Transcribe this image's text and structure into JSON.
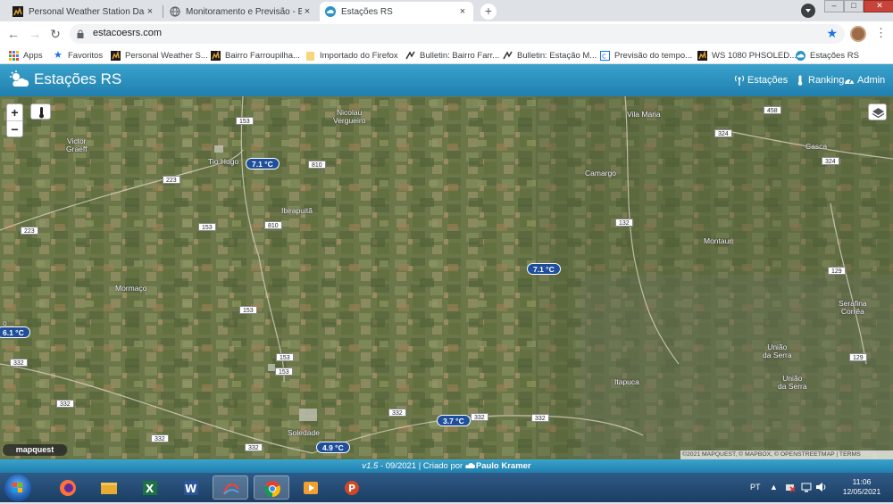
{
  "browser": {
    "tabs": [
      {
        "title": "Personal Weather Station Dashbo",
        "close": "×"
      },
      {
        "title": "Monitoramento e Previsão - Bras",
        "close": "×"
      },
      {
        "title": "Estações RS",
        "close": "×"
      }
    ],
    "new_tab": "+",
    "window_controls": {
      "minimize": "‒",
      "maximize": "□",
      "close": "✕"
    },
    "back": "←",
    "forward": "→",
    "reload": "↻",
    "url": "estacoesrs.com",
    "star": "★",
    "menu": "⋮",
    "bookmarks": [
      {
        "label": "Apps"
      },
      {
        "label": "Favoritos"
      },
      {
        "label": "Personal Weather S..."
      },
      {
        "label": "Bairro Farroupilha..."
      },
      {
        "label": "Importado do Firefox"
      },
      {
        "label": "Bulletin: Bairro Farr..."
      },
      {
        "label": "Bulletin: Estação M..."
      },
      {
        "label": "Previsão do tempo..."
      },
      {
        "label": "WS 1080 PHSOLED..."
      },
      {
        "label": "Estações RS"
      }
    ]
  },
  "app": {
    "brand": "Estações RS",
    "nav": {
      "stations": "Estações",
      "ranking": "Ranking",
      "admin": "Admin"
    }
  },
  "map": {
    "zoom_in": "+",
    "zoom_out": "−",
    "places": [
      {
        "name": "Nicolau\nVergueiro"
      },
      {
        "name": "Vila Maria"
      },
      {
        "name": "Victor\nGraeff"
      },
      {
        "name": "Tio Hugo"
      },
      {
        "name": "Casca"
      },
      {
        "name": "Camargo"
      },
      {
        "name": "Ibirapuitã"
      },
      {
        "name": "Montauri"
      },
      {
        "name": "Mormaço"
      },
      {
        "name": "Serafina\nCorrêa"
      },
      {
        "name": "União\nda Serra"
      },
      {
        "name": "União\nda Serra"
      },
      {
        "name": "Itapuca"
      },
      {
        "name": "Soledade"
      },
      {
        "name": "o"
      }
    ],
    "roads": [
      "153",
      "458",
      "324",
      "324",
      "810",
      "223",
      "223",
      "153",
      "810",
      "132",
      "153",
      "129",
      "332",
      "153",
      "153",
      "129",
      "332",
      "332",
      "332",
      "332",
      "332",
      "332"
    ],
    "stations": [
      "7.1 °C",
      "7.1 °C",
      "6.1 °C",
      "3.7 °C",
      "4.9 °C"
    ],
    "logo": "mapquest",
    "attribution": "©2021 MAPQUEST, © MAPBOX, © OPENSTREETMAP | TERMS"
  },
  "footer": {
    "version": "v1.5",
    "date": " - 09/2021 | Criado por ",
    "author": "Paulo Kramer"
  },
  "taskbar": {
    "lang": "PT",
    "tray_arrow": "▲",
    "time": "11:06",
    "date": "12/05/2021"
  }
}
